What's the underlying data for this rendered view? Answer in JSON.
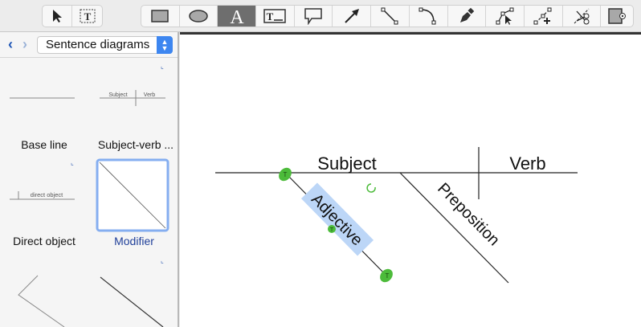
{
  "toolbar": {
    "groups": [
      [
        "pointer-icon",
        "text-box-icon"
      ],
      [
        "rectangle-icon",
        "ellipse-icon",
        "text-icon",
        "text-field-icon",
        "callout-icon",
        "arrow-icon",
        "line-icon",
        "arc-icon",
        "pen-icon",
        "select-point-icon",
        "add-point-icon",
        "scissors-icon",
        "container-icon"
      ]
    ],
    "selected": "text-icon",
    "text_glyph": "A",
    "textbox_glyph": "T"
  },
  "sidebar": {
    "library": "Sentence diagrams",
    "items": [
      {
        "label": "Base line"
      },
      {
        "label": "Subject-verb ...",
        "preview_subject": "Subject",
        "preview_verb": "Verb"
      },
      {
        "label": "Direct object",
        "preview": "direct object"
      },
      {
        "label": "Modifier",
        "selected": true
      },
      {
        "label": ""
      },
      {
        "label": ""
      }
    ]
  },
  "canvas": {
    "subject": "Subject",
    "verb": "Verb",
    "adjective": "Adjective",
    "preposition": "Preposition"
  },
  "colors": {
    "accent": "#3d86f0",
    "selection": "#bcd6f7",
    "handle": "#4cbb3a",
    "selected_label": "#1f3f99"
  }
}
